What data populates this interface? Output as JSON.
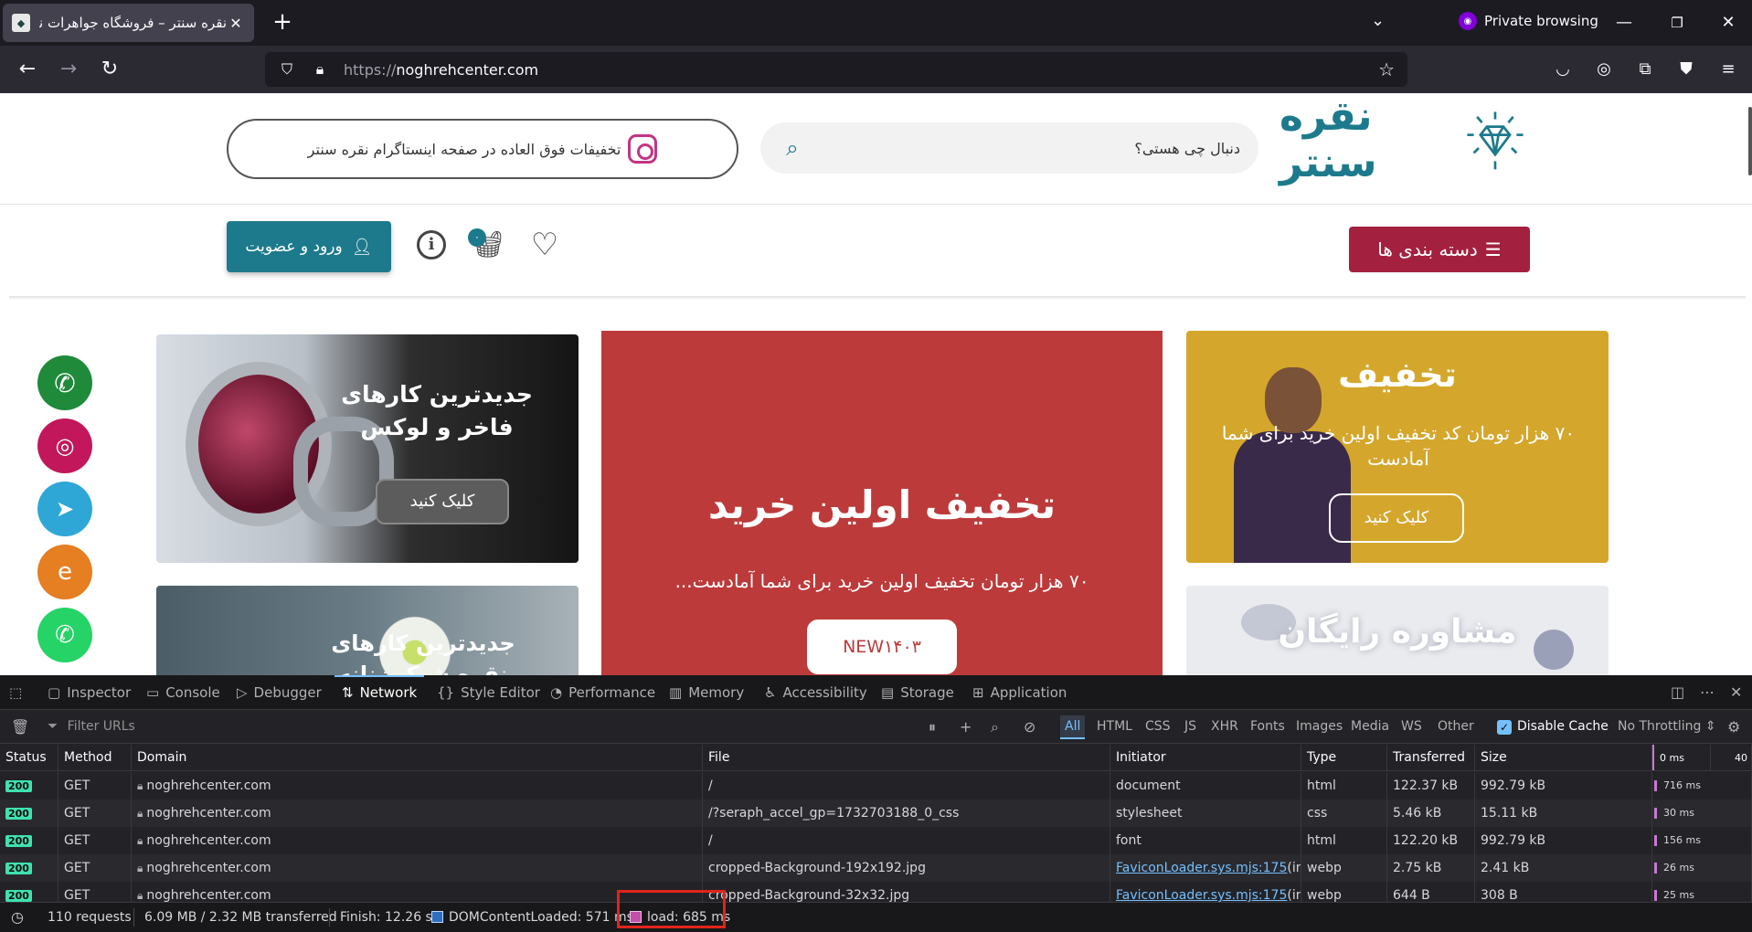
{
  "browser": {
    "tab_title": "نقره سنتر – فروشگاه جواهرات نقره",
    "new_tab": "+",
    "private_label": "Private browsing",
    "url_proto": "https://",
    "url_host": "noghrehcenter.com"
  },
  "site": {
    "logo_text": "نقره سنتر",
    "search_placeholder": "دنبال چی هستی؟",
    "insta_promo": "تخفیفات فوق العاده در صفحه اینستاگرام نقره سنتر",
    "categories_label": "دسته بندی ها",
    "login_label": "ورود و عضویت",
    "cart_count": "۰",
    "banners": {
      "ring": {
        "title": "جدیدترین کارهای فاخر و لوکس",
        "button": "کلیک کنید"
      },
      "first_purchase": {
        "title": "تخفیف اولین خرید",
        "text": "۷۰ هزار تومان تخفیف اولین خرید برای شما آمادست...",
        "code": "NEW۱۴۰۳"
      },
      "discount": {
        "title": "تخفیف",
        "text": "۷۰ هزار تومان کد تخفیف اولین خرید برای شما آمادست",
        "button": "کلیک کنید"
      },
      "ring2": {
        "title": "جدیدترین کارهای نقره شیک زنانه"
      },
      "consult": {
        "title": "مشاوره رایگان"
      }
    },
    "social_colors": {
      "phone": "#1e8a3a",
      "instagram": "#c2185b",
      "telegram": "#2ea7d6",
      "eitaa": "#e67e22",
      "whatsapp": "#25d366"
    }
  },
  "devtools": {
    "tabs": [
      "Inspector",
      "Console",
      "Debugger",
      "Network",
      "Style Editor",
      "Performance",
      "Memory",
      "Accessibility",
      "Storage",
      "Application"
    ],
    "active_tab": "Network",
    "filter_placeholder": "Filter URLs",
    "filter_types": [
      "All",
      "HTML",
      "CSS",
      "JS",
      "XHR",
      "Fonts",
      "Images",
      "Media",
      "WS",
      "Other"
    ],
    "disable_cache": "Disable Cache",
    "throttling": "No Throttling",
    "columns": [
      "Status",
      "Method",
      "Domain",
      "File",
      "Initiator",
      "Type",
      "Transferred",
      "Size"
    ],
    "waterfall_ticks": [
      "0 ms",
      "40"
    ],
    "rows": [
      {
        "status": "200",
        "method": "GET",
        "domain": "noghrehcenter.com",
        "file": "/",
        "initiator": "document",
        "initiator_suffix": "",
        "type": "html",
        "transferred": "122.37 kB",
        "size": "992.79 kB",
        "ms": "716 ms"
      },
      {
        "status": "200",
        "method": "GET",
        "domain": "noghrehcenter.com",
        "file": "/?seraph_accel_gp=1732703188_0_css",
        "initiator": "stylesheet",
        "initiator_suffix": "",
        "type": "css",
        "transferred": "5.46 kB",
        "size": "15.11 kB",
        "ms": "30 ms"
      },
      {
        "status": "200",
        "method": "GET",
        "domain": "noghrehcenter.com",
        "file": "/",
        "initiator": "font",
        "initiator_suffix": "",
        "type": "html",
        "transferred": "122.20 kB",
        "size": "992.79 kB",
        "ms": "156 ms"
      },
      {
        "status": "200",
        "method": "GET",
        "domain": "noghrehcenter.com",
        "file": "cropped-Background-192x192.jpg",
        "initiator": "FaviconLoader.sys.mjs:175",
        "initiator_suffix": " (img)",
        "type": "webp",
        "transferred": "2.75 kB",
        "size": "2.41 kB",
        "ms": "26 ms"
      },
      {
        "status": "200",
        "method": "GET",
        "domain": "noghrehcenter.com",
        "file": "cropped-Background-32x32.jpg",
        "initiator": "FaviconLoader.sys.mjs:175",
        "initiator_suffix": " (img)",
        "type": "webp",
        "transferred": "644 B",
        "size": "308 B",
        "ms": "25 ms"
      }
    ],
    "status_bar": {
      "requests": "110 requests",
      "transferred": "6.09 MB / 2.32 MB transferred",
      "finish": "Finish: 12.26 s",
      "dcl": "DOMContentLoaded: 571 ms",
      "load": "load: 685 ms"
    }
  }
}
